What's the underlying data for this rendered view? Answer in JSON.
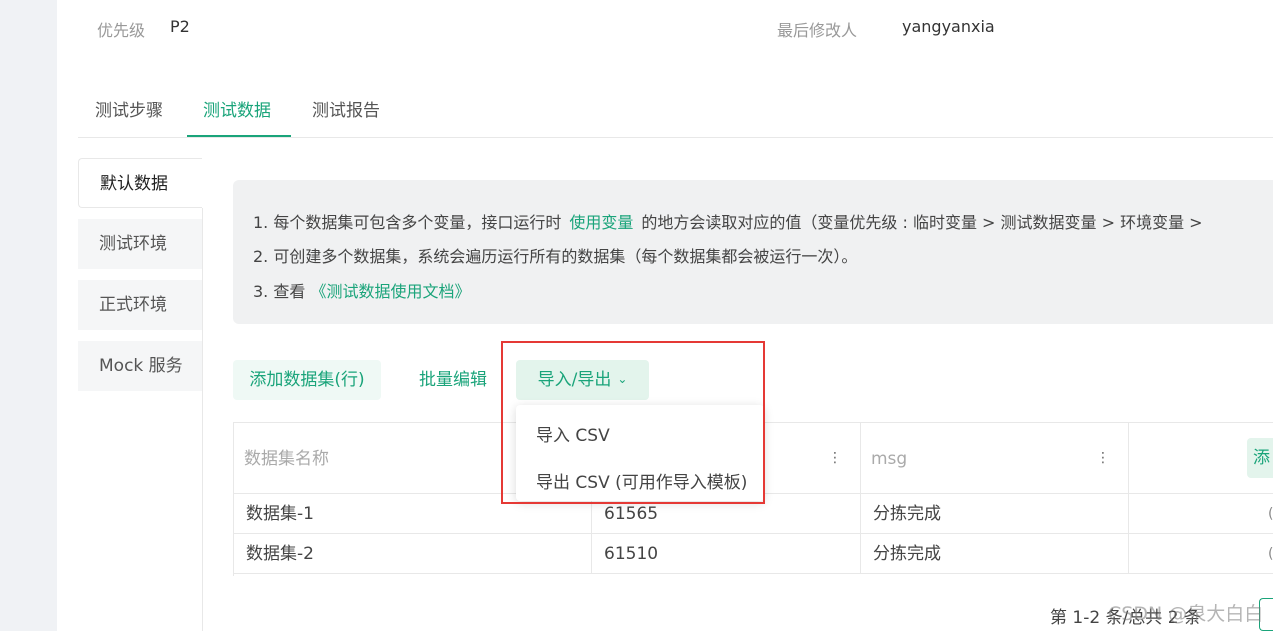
{
  "meta": {
    "priority_label": "优先级",
    "priority_value": "P2",
    "modifier_label": "最后修改人",
    "modifier_value": "yangyanxia"
  },
  "tabs": [
    {
      "label": "测试步骤",
      "active": false
    },
    {
      "label": "测试数据",
      "active": true
    },
    {
      "label": "测试报告",
      "active": false
    }
  ],
  "environments": [
    {
      "label": "默认数据",
      "active": true
    },
    {
      "label": "测试环境",
      "active": false
    },
    {
      "label": "正式环境",
      "active": false
    },
    {
      "label": "Mock 服务",
      "active": false
    }
  ],
  "info": {
    "line1_pre": "1. 每个数据集可包含多个变量，接口运行时",
    "line1_link": "使用变量",
    "line1_post": "的地方会读取对应的值（变量优先级 : 临时变量 > 测试数据变量 > 环境变量 >",
    "line2": "2. 可创建多个数据集，系统会遍历运行所有的数据集（每个数据集都会被运行一次）。",
    "line3_pre": "3. 查看",
    "line3_link": "《测试数据使用文档》"
  },
  "actions": {
    "add_label": "添加数据集(行)",
    "batch_label": "批量编辑",
    "import_export_label": "导入/导出",
    "chevron_glyph": "⌄"
  },
  "dropdown": {
    "items": [
      "导入 CSV",
      "导出 CSV (可用作导入模板)"
    ]
  },
  "table": {
    "headers": [
      "数据集名称",
      "",
      "msg"
    ],
    "column_menu_glyph": "⋮",
    "op_header_partial": "添",
    "rows": [
      {
        "name": "数据集-1",
        "value": "61565",
        "msg": "分拣完成",
        "op": "("
      },
      {
        "name": "数据集-2",
        "value": "61510",
        "msg": "分拣完成",
        "op": "("
      }
    ]
  },
  "pagination": {
    "text": "第 1-2 条/总共 2 条"
  },
  "watermark": {
    "text": "CSDN @泉大白白"
  },
  "colors": {
    "accent": "#1aa47a",
    "highlight_box": "#e53935"
  }
}
